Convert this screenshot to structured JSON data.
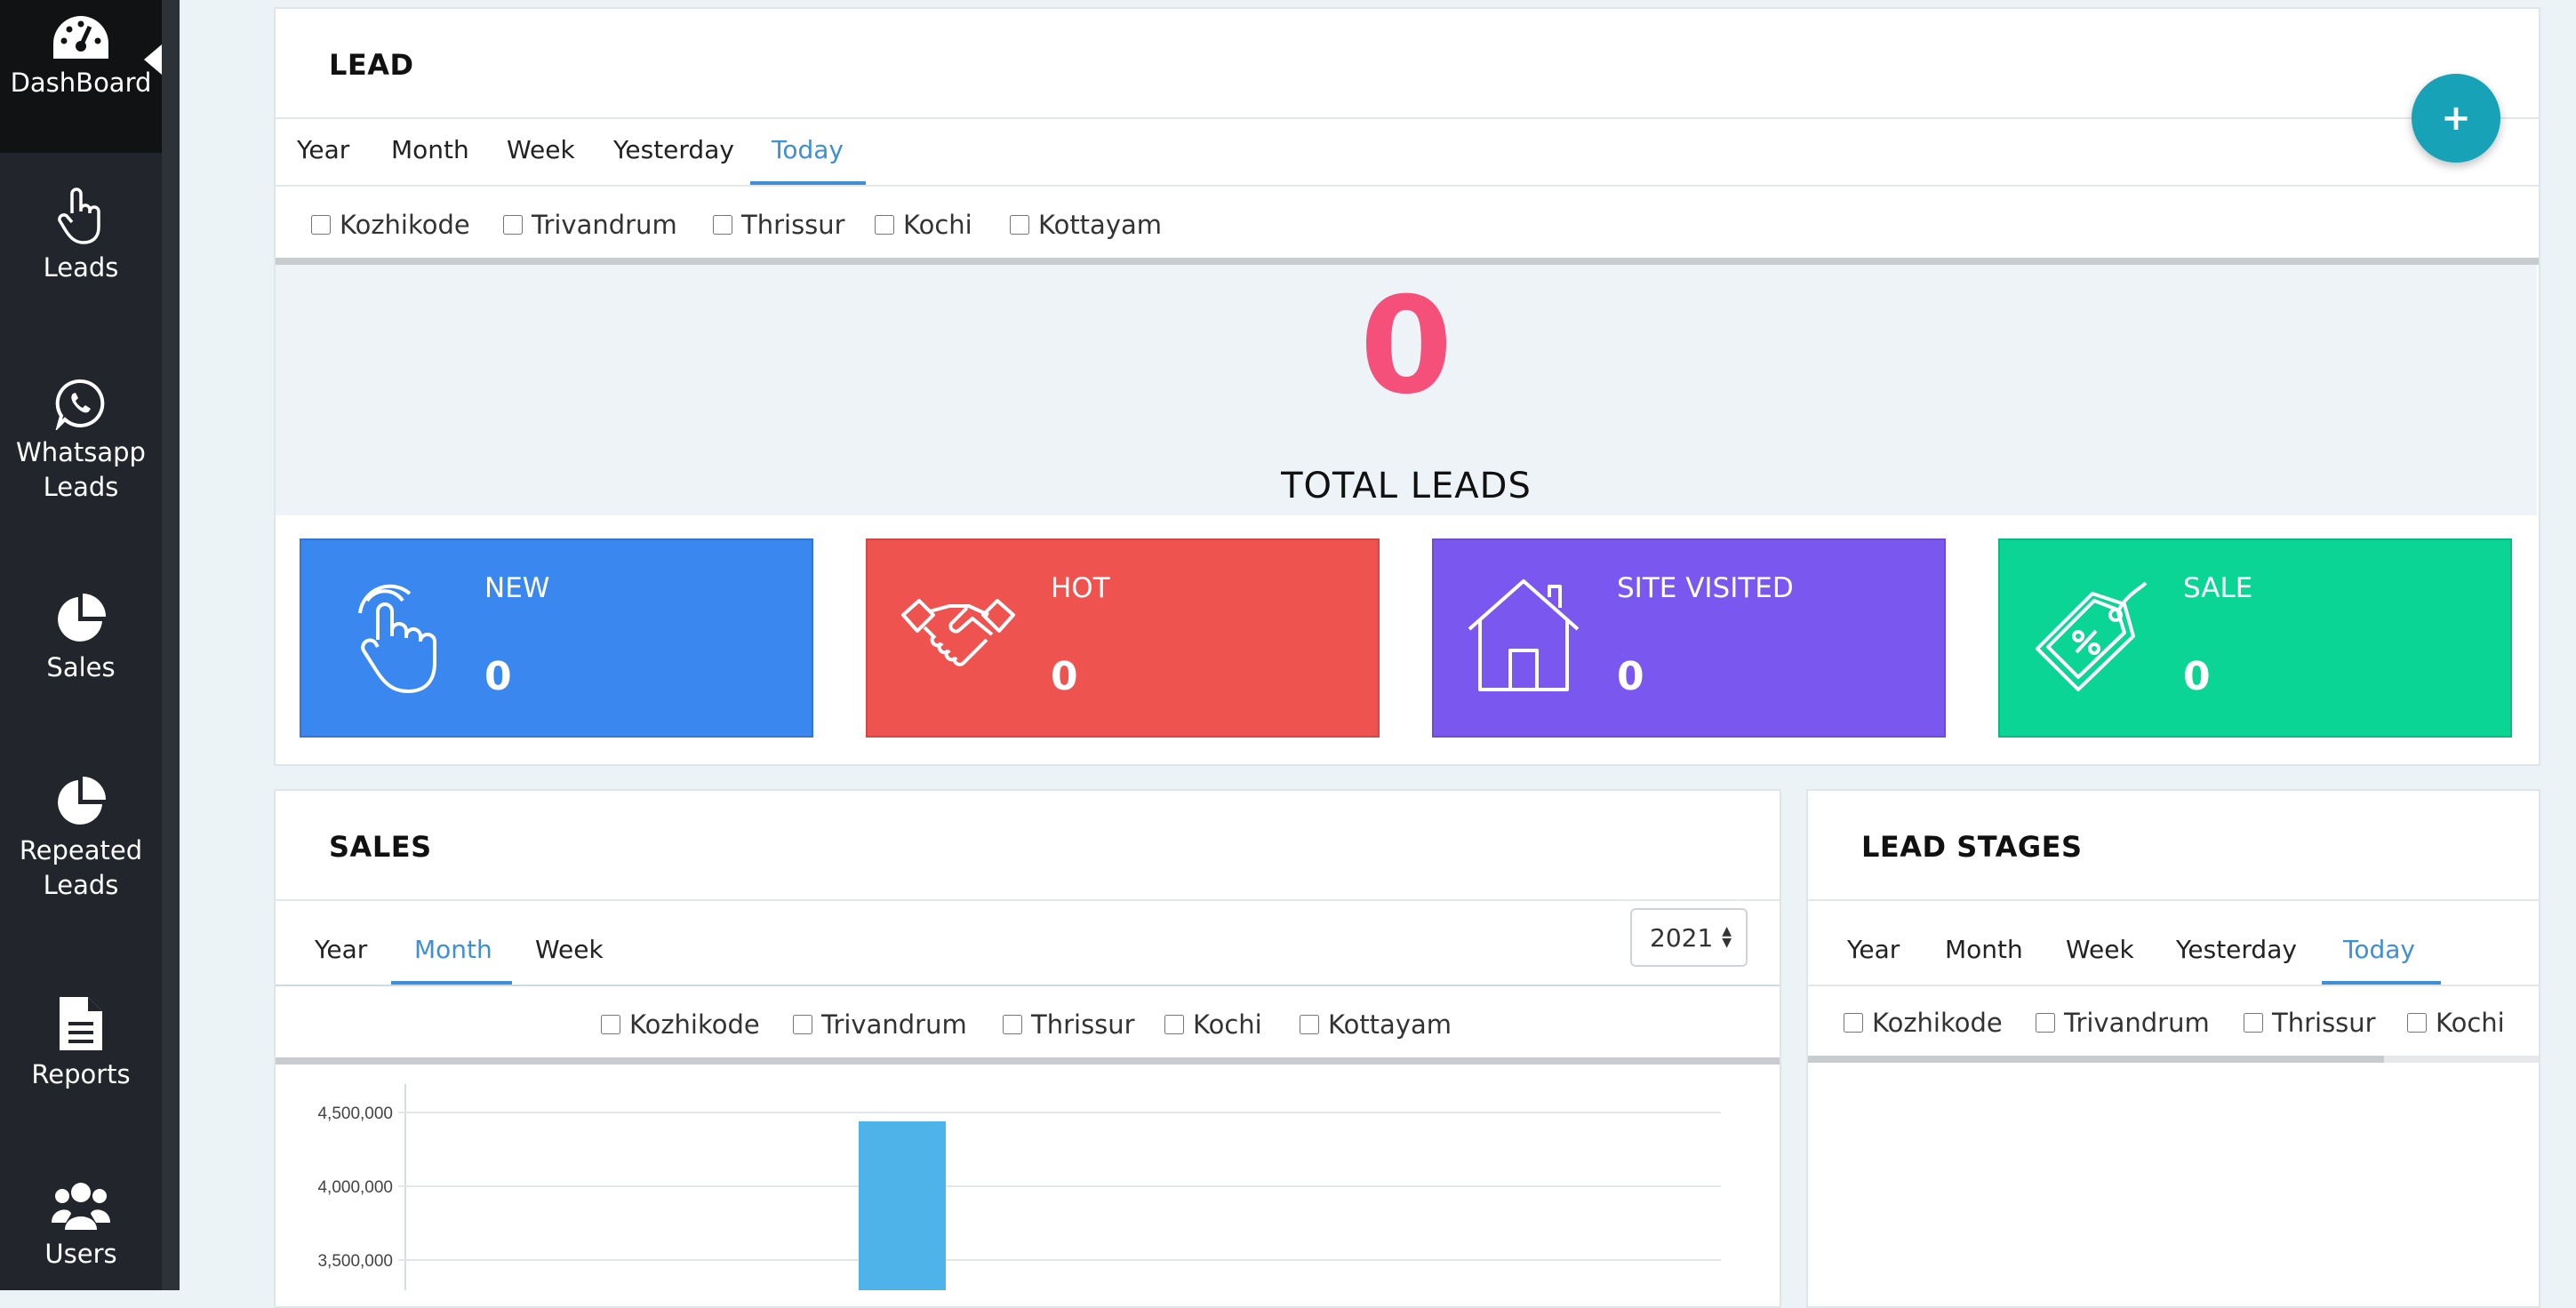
{
  "sidebar": {
    "items": [
      {
        "label": "DashBoard",
        "icon": "dashboard-gauge-icon",
        "active": true
      },
      {
        "label": "Leads",
        "icon": "hand-pointer-icon"
      },
      {
        "label": "Whatsapp Leads",
        "icon": "whatsapp-icon"
      },
      {
        "label": "Sales",
        "icon": "pie-chart-icon"
      },
      {
        "label": "Repeated Leads",
        "icon": "pie-chart-icon"
      },
      {
        "label": "Reports",
        "icon": "document-icon"
      },
      {
        "label": "Users",
        "icon": "users-icon"
      }
    ]
  },
  "lead_panel": {
    "title": "LEAD",
    "fab_label": "+",
    "tabs": [
      "Year",
      "Month",
      "Week",
      "Yesterday",
      "Today"
    ],
    "active_tab": "Today",
    "locations": [
      "Kozhikode",
      "Trivandrum",
      "Thrissur",
      "Kochi",
      "Kottayam"
    ],
    "total_value": "0",
    "total_label": "TOTAL LEADS",
    "stats": [
      {
        "label": "NEW",
        "value": "0",
        "color": "#3b87f0",
        "icon": "hand-tap-icon"
      },
      {
        "label": "HOT",
        "value": "0",
        "color": "#ef5350",
        "icon": "handshake-icon"
      },
      {
        "label": "SITE VISITED",
        "value": "0",
        "color": "#7a57ef",
        "icon": "house-icon"
      },
      {
        "label": "SALE",
        "value": "0",
        "color": "#0ad594",
        "icon": "price-tag-icon"
      }
    ]
  },
  "sales_panel": {
    "title": "SALES",
    "tabs": [
      "Year",
      "Month",
      "Week"
    ],
    "active_tab": "Month",
    "year_select": "2021",
    "locations": [
      "Kozhikode",
      "Trivandrum",
      "Thrissur",
      "Kochi",
      "Kottayam"
    ]
  },
  "lead_stages_panel": {
    "title": "LEAD STAGES",
    "tabs": [
      "Year",
      "Month",
      "Week",
      "Yesterday",
      "Today"
    ],
    "active_tab": "Today",
    "locations": [
      "Kozhikode",
      "Trivandrum",
      "Thrissur",
      "Kochi"
    ]
  },
  "chart_data": {
    "type": "bar",
    "y_tick_labels": [
      "4,500,000",
      "4,000,000",
      "3,500,000"
    ],
    "y_ticks": [
      4500000,
      4000000,
      3500000
    ],
    "ylim_visible": [
      3300000,
      4700000
    ],
    "bar_color": "#4db3e8",
    "bars": [
      {
        "value": 4440000
      }
    ]
  }
}
